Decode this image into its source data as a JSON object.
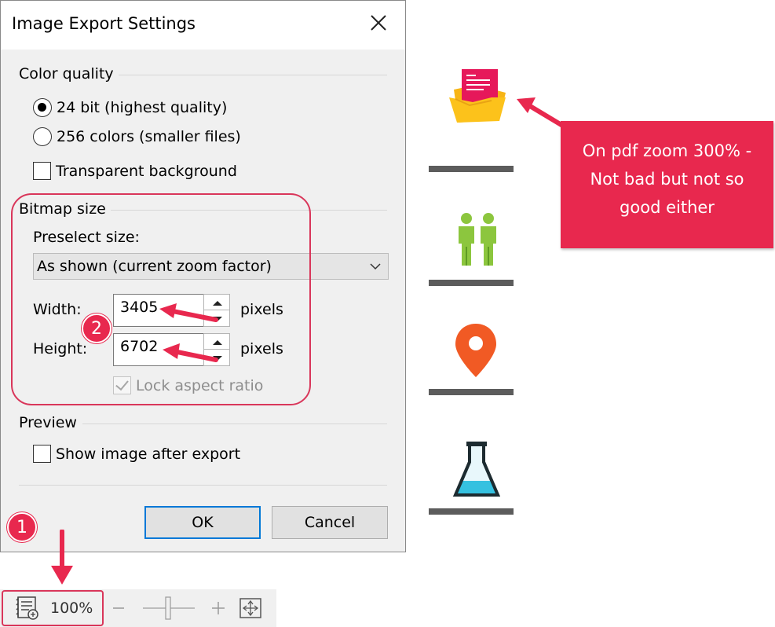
{
  "dialog": {
    "title": "Image Export Settings",
    "color_quality": {
      "label": "Color quality",
      "options": [
        {
          "label": "24 bit (highest quality)",
          "selected": true
        },
        {
          "label": "256 colors (smaller files)",
          "selected": false
        }
      ],
      "transparent_background": {
        "label": "Transparent background",
        "checked": false
      }
    },
    "bitmap_size": {
      "label": "Bitmap size",
      "preselect_label": "Preselect size:",
      "preselect_value": "As shown (current zoom factor)",
      "width_label": "Width:",
      "width_value": "3405",
      "height_label": "Height:",
      "height_value": "6702",
      "unit": "pixels",
      "lock_aspect_ratio": {
        "label": "Lock aspect ratio",
        "checked": true,
        "enabled": false
      }
    },
    "preview": {
      "label": "Preview",
      "show_after_export": {
        "label": "Show image after export",
        "checked": false
      }
    },
    "ok_label": "OK",
    "cancel_label": "Cancel"
  },
  "annotations": {
    "badge_1": "1",
    "badge_2": "2",
    "tooltip": [
      "On pdf zoom 300% -",
      "Not bad but not so",
      "good either"
    ]
  },
  "statusbar": {
    "zoom": "100%"
  },
  "icons": [
    "mail-folder-icon",
    "people-icon",
    "location-pin-icon",
    "flask-icon"
  ],
  "colors": {
    "accent": "#e8284e",
    "dialog_bg": "#f0f0f0",
    "focus_border": "#0078d7"
  }
}
